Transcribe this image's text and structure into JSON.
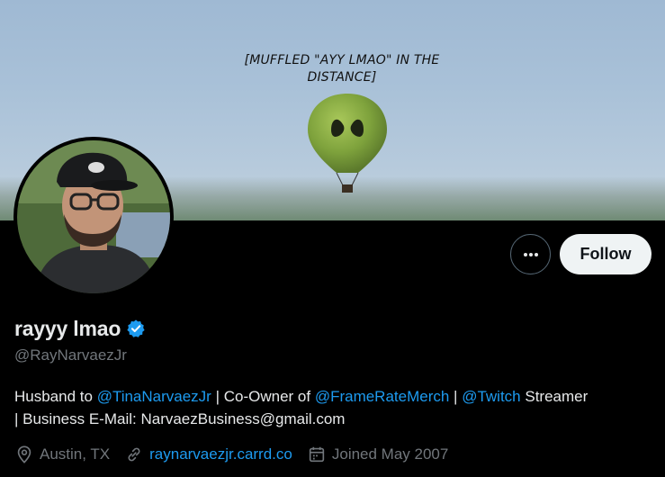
{
  "banner": {
    "caption_line1": "[MUFFLED \"AYY LMAO\" IN THE",
    "caption_line2": "DISTANCE]"
  },
  "actions": {
    "more_icon": "more-horizontal-icon",
    "follow_label": "Follow"
  },
  "profile": {
    "display_name": "rayyy lmao",
    "verified_icon": "verified-badge-icon",
    "handle": "@RayNarvaezJr"
  },
  "bio": {
    "line1_text1": "Husband to ",
    "mention1": "@TinaNarvaezJr",
    "line1_text2": " | Co-Owner of ",
    "mention2": "@FrameRateMerch",
    "line1_text3": " | ",
    "mention3": "@Twitch",
    "line1_text4": " Streamer",
    "line2": "| Business E-Mail: NarvaezBusiness@gmail.com"
  },
  "meta": {
    "location_icon": "location-pin-icon",
    "location": "Austin, TX",
    "link_icon": "link-icon",
    "website": "raynarvaezjr.carrd.co",
    "calendar_icon": "calendar-icon",
    "joined": "Joined May 2007"
  },
  "colors": {
    "accent": "#1d9bf0",
    "secondary_text": "#71767b",
    "follow_bg": "#eff3f4"
  }
}
